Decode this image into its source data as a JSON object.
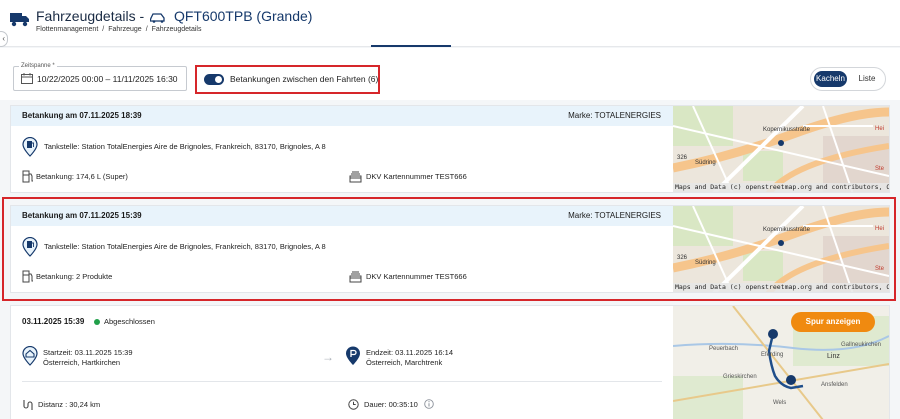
{
  "header": {
    "title": "Fahrzeugdetails -",
    "plate": "QFT600TPB (Grande)",
    "breadcrumb": [
      "Flottenmanagement",
      "Fahrzeuge",
      "Fahrzeugdetails"
    ],
    "collapse_glyph": "‹"
  },
  "filters": {
    "date_label": "Zeitspanne *",
    "date_value": "10/22/2025 00:00 – 11/11/2025 16:30",
    "toggle_label": "Betankungen zwischen den Fahrten (6)",
    "toggle_on": true,
    "view_active": "Kacheln",
    "view_inactive": "Liste"
  },
  "refuels": [
    {
      "title": "Betankung am 07.11.2025 18:39",
      "brand": "Marke: TOTALENERGIES",
      "station": "Tankstelle:  Station TotalEnergies Aire de Brignoles, Frankreich, 83170, Brignoles, A 8",
      "fuel": "Betankung: 174,6 L (Super)",
      "card": "DKV Kartennummer TEST666",
      "map_credit": "Maps and Data (c) openstreetmap.org and contributors, ODbL"
    },
    {
      "title": "Betankung am 07.11.2025 15:39",
      "brand": "Marke: TOTALENERGIES",
      "station": "Tankstelle:  Station TotalEnergies Aire de Brignoles, Frankreich, 83170, Brignoles, A 8",
      "fuel": "Betankung: 2 Produkte",
      "card": "DKV Kartennummer TEST666",
      "map_credit": "Maps and Data (c) openstreetmap.org and contributors, ODbL"
    }
  ],
  "map_labels": {
    "street_a": "Kopernikusstraße",
    "street_b": "Südring",
    "road_num": "326",
    "suffix_a": "Hei",
    "suffix_b": "Ste"
  },
  "trip": {
    "date": "03.11.2025 15:39",
    "status": "Abgeschlossen",
    "start_time": "Startzeit: 03.11.2025 15:39",
    "start_place": "Österreich, Hartkirchen",
    "end_time": "Endzeit: 03.11.2025 16:14",
    "end_place": "Österreich, Marchtrenk",
    "distance": "Distanz : 30,24 km",
    "duration": "Dauer: 00:35:10",
    "track_button": "Spur anzeigen",
    "map_labels": {
      "peuerbach": "Peuerbach",
      "linz": "Linz",
      "gallneukirchen": "Gallneukirchen",
      "grieskirchen": "Grieskirchen",
      "ansfelden": "Ansfelden",
      "wels": "Wels",
      "eferding": "Eferding"
    }
  },
  "colors": {
    "primary": "#16396b",
    "highlight": "#d6262a",
    "accent_orange": "#f08a10",
    "status_green": "#21a04a",
    "card_header": "#e8f3fb"
  }
}
